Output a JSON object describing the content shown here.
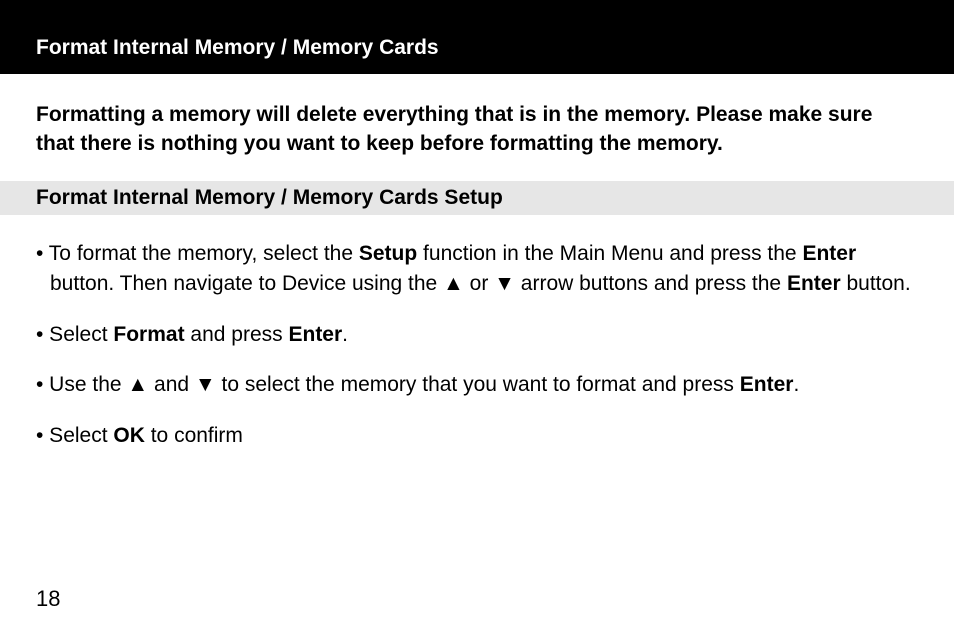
{
  "header": {
    "title": "Format Internal Memory / Memory Cards"
  },
  "warning": {
    "text": "Formatting a memory will delete everything that is in the memory. Please make sure that there is nothing you want to keep before formatting the memory."
  },
  "subheader": {
    "title": "Format Internal Memory / Memory Cards Setup"
  },
  "bullets": {
    "b1_pre": "• To format the memory, select the ",
    "b1_setup": "Setup",
    "b1_mid1": " function in the Main Menu and press the ",
    "b1_enter1": "Enter",
    "b1_mid2": " button.  Then navigate to Device using the ▲ or ▼ arrow buttons and press the ",
    "b1_enter2": "Enter",
    "b1_post": " button.",
    "b2_pre": "• Select ",
    "b2_format": "Format",
    "b2_mid": " and press ",
    "b2_enter": "Enter",
    "b2_post": ".",
    "b3_pre": "• Use the ▲ and ▼ to select the memory that you want to format and press ",
    "b3_enter": "Enter",
    "b3_post": ".",
    "b4_pre": "• Select ",
    "b4_ok": "OK",
    "b4_post": " to confirm"
  },
  "page_number": "18"
}
